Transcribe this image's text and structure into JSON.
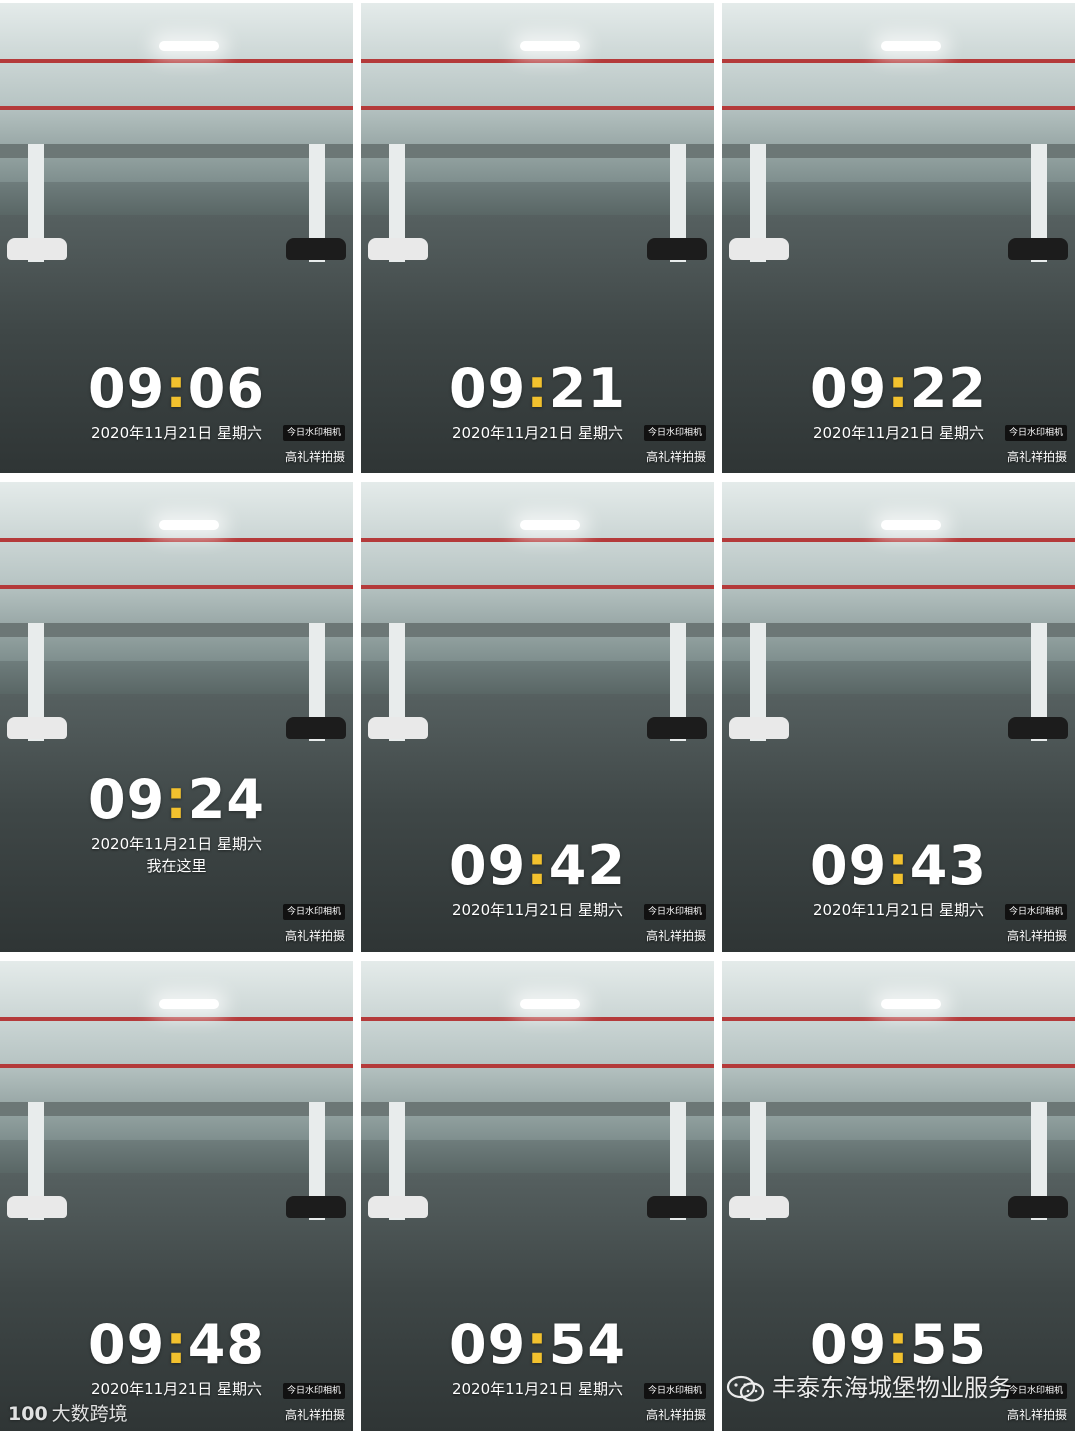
{
  "photos": [
    {
      "time_h": "09",
      "time_m": "06",
      "date": "2020年11月21日 星期六",
      "note": "",
      "badge": "今日水印相机",
      "credit": "高礼祥拍摄"
    },
    {
      "time_h": "09",
      "time_m": "21",
      "date": "2020年11月21日 星期六",
      "note": "",
      "badge": "今日水印相机",
      "credit": "高礼祥拍摄"
    },
    {
      "time_h": "09",
      "time_m": "22",
      "date": "2020年11月21日 星期六",
      "note": "",
      "badge": "今日水印相机",
      "credit": "高礼祥拍摄"
    },
    {
      "time_h": "09",
      "time_m": "24",
      "date": "2020年11月21日 星期六",
      "note": "我在这里",
      "badge": "今日水印相机",
      "credit": "高礼祥拍摄"
    },
    {
      "time_h": "09",
      "time_m": "42",
      "date": "2020年11月21日 星期六",
      "note": "",
      "badge": "今日水印相机",
      "credit": "高礼祥拍摄"
    },
    {
      "time_h": "09",
      "time_m": "43",
      "date": "2020年11月21日 星期六",
      "note": "",
      "badge": "今日水印相机",
      "credit": "高礼祥拍摄"
    },
    {
      "time_h": "09",
      "time_m": "48",
      "date": "2020年11月21日 星期六",
      "note": "",
      "badge": "今日水印相机",
      "credit": "高礼祥拍摄"
    },
    {
      "time_h": "09",
      "time_m": "54",
      "date": "2020年11月21日 星期六",
      "note": "",
      "badge": "今日水印相机",
      "credit": "高礼祥拍摄"
    },
    {
      "time_h": "09",
      "time_m": "55",
      "date": "",
      "note": "",
      "badge": "今日水印相机",
      "credit": "高礼祥拍摄"
    }
  ],
  "colon": ":",
  "watermark_left": {
    "logo": "100",
    "text": "大数跨境"
  },
  "watermark_right": {
    "text": "丰泰东海城堡物业服务"
  },
  "colors": {
    "colon_accent": "#f2c12e",
    "pipe": "#b43a3a"
  }
}
